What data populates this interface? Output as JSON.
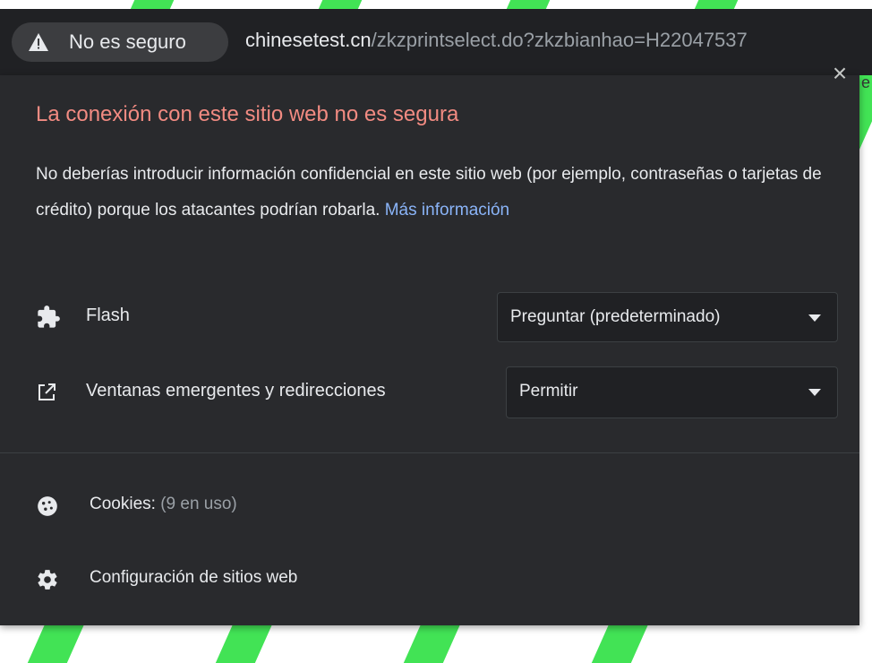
{
  "address_bar": {
    "security_chip": "No es seguro",
    "domain": "chinesetest.cn",
    "path": "/zkzprintselect.do?zkzbianhao=H22047537"
  },
  "popup": {
    "title": "La conexión con este sitio web no es segura",
    "description": "No deberías introducir información confidencial en este sitio web (por ejemplo, contraseñas o tarjetas de crédito) porque los atacantes podrían robarla. ",
    "more_info_link": "Más información",
    "permissions": [
      {
        "icon": "puzzle-icon",
        "label": "Flash",
        "value": "Preguntar (predeterminado)"
      },
      {
        "icon": "open-in-new-icon",
        "label": "Ventanas emergentes y redirecciones",
        "value": "Permitir"
      }
    ],
    "cookies": {
      "label": "Cookies:",
      "count_text": "(9 en uso)"
    },
    "site_settings": "Configuración de sitios web"
  },
  "colors": {
    "warning_title": "#f28b82",
    "link": "#8ab4f8",
    "popup_bg": "#292a2d",
    "stripe_green": "#36e34f"
  }
}
